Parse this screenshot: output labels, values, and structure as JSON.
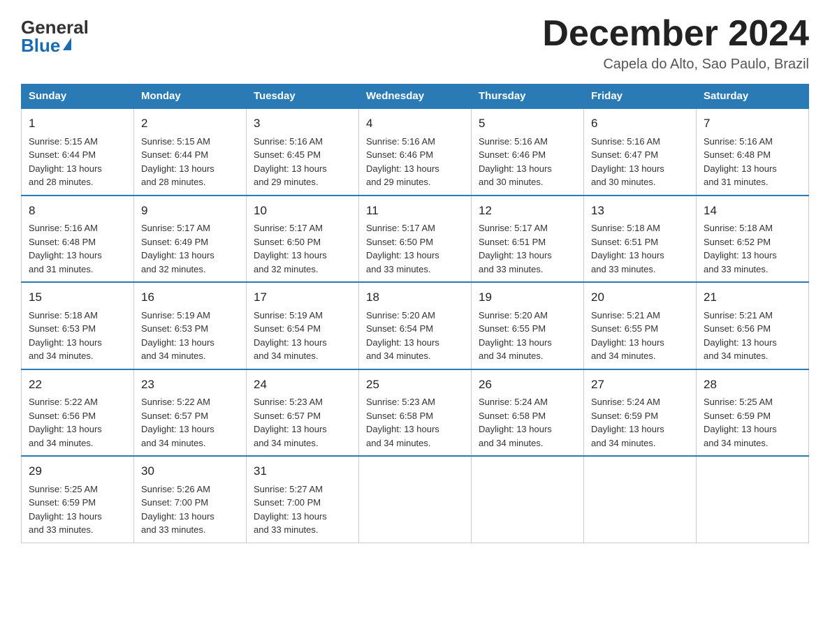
{
  "header": {
    "logo_general": "General",
    "logo_blue": "Blue",
    "month_year": "December 2024",
    "location": "Capela do Alto, Sao Paulo, Brazil"
  },
  "days_of_week": [
    "Sunday",
    "Monday",
    "Tuesday",
    "Wednesday",
    "Thursday",
    "Friday",
    "Saturday"
  ],
  "weeks": [
    [
      {
        "day": "1",
        "sunrise": "5:15 AM",
        "sunset": "6:44 PM",
        "daylight": "13 hours and 28 minutes."
      },
      {
        "day": "2",
        "sunrise": "5:15 AM",
        "sunset": "6:44 PM",
        "daylight": "13 hours and 28 minutes."
      },
      {
        "day": "3",
        "sunrise": "5:16 AM",
        "sunset": "6:45 PM",
        "daylight": "13 hours and 29 minutes."
      },
      {
        "day": "4",
        "sunrise": "5:16 AM",
        "sunset": "6:46 PM",
        "daylight": "13 hours and 29 minutes."
      },
      {
        "day": "5",
        "sunrise": "5:16 AM",
        "sunset": "6:46 PM",
        "daylight": "13 hours and 30 minutes."
      },
      {
        "day": "6",
        "sunrise": "5:16 AM",
        "sunset": "6:47 PM",
        "daylight": "13 hours and 30 minutes."
      },
      {
        "day": "7",
        "sunrise": "5:16 AM",
        "sunset": "6:48 PM",
        "daylight": "13 hours and 31 minutes."
      }
    ],
    [
      {
        "day": "8",
        "sunrise": "5:16 AM",
        "sunset": "6:48 PM",
        "daylight": "13 hours and 31 minutes."
      },
      {
        "day": "9",
        "sunrise": "5:17 AM",
        "sunset": "6:49 PM",
        "daylight": "13 hours and 32 minutes."
      },
      {
        "day": "10",
        "sunrise": "5:17 AM",
        "sunset": "6:50 PM",
        "daylight": "13 hours and 32 minutes."
      },
      {
        "day": "11",
        "sunrise": "5:17 AM",
        "sunset": "6:50 PM",
        "daylight": "13 hours and 33 minutes."
      },
      {
        "day": "12",
        "sunrise": "5:17 AM",
        "sunset": "6:51 PM",
        "daylight": "13 hours and 33 minutes."
      },
      {
        "day": "13",
        "sunrise": "5:18 AM",
        "sunset": "6:51 PM",
        "daylight": "13 hours and 33 minutes."
      },
      {
        "day": "14",
        "sunrise": "5:18 AM",
        "sunset": "6:52 PM",
        "daylight": "13 hours and 33 minutes."
      }
    ],
    [
      {
        "day": "15",
        "sunrise": "5:18 AM",
        "sunset": "6:53 PM",
        "daylight": "13 hours and 34 minutes."
      },
      {
        "day": "16",
        "sunrise": "5:19 AM",
        "sunset": "6:53 PM",
        "daylight": "13 hours and 34 minutes."
      },
      {
        "day": "17",
        "sunrise": "5:19 AM",
        "sunset": "6:54 PM",
        "daylight": "13 hours and 34 minutes."
      },
      {
        "day": "18",
        "sunrise": "5:20 AM",
        "sunset": "6:54 PM",
        "daylight": "13 hours and 34 minutes."
      },
      {
        "day": "19",
        "sunrise": "5:20 AM",
        "sunset": "6:55 PM",
        "daylight": "13 hours and 34 minutes."
      },
      {
        "day": "20",
        "sunrise": "5:21 AM",
        "sunset": "6:55 PM",
        "daylight": "13 hours and 34 minutes."
      },
      {
        "day": "21",
        "sunrise": "5:21 AM",
        "sunset": "6:56 PM",
        "daylight": "13 hours and 34 minutes."
      }
    ],
    [
      {
        "day": "22",
        "sunrise": "5:22 AM",
        "sunset": "6:56 PM",
        "daylight": "13 hours and 34 minutes."
      },
      {
        "day": "23",
        "sunrise": "5:22 AM",
        "sunset": "6:57 PM",
        "daylight": "13 hours and 34 minutes."
      },
      {
        "day": "24",
        "sunrise": "5:23 AM",
        "sunset": "6:57 PM",
        "daylight": "13 hours and 34 minutes."
      },
      {
        "day": "25",
        "sunrise": "5:23 AM",
        "sunset": "6:58 PM",
        "daylight": "13 hours and 34 minutes."
      },
      {
        "day": "26",
        "sunrise": "5:24 AM",
        "sunset": "6:58 PM",
        "daylight": "13 hours and 34 minutes."
      },
      {
        "day": "27",
        "sunrise": "5:24 AM",
        "sunset": "6:59 PM",
        "daylight": "13 hours and 34 minutes."
      },
      {
        "day": "28",
        "sunrise": "5:25 AM",
        "sunset": "6:59 PM",
        "daylight": "13 hours and 34 minutes."
      }
    ],
    [
      {
        "day": "29",
        "sunrise": "5:25 AM",
        "sunset": "6:59 PM",
        "daylight": "13 hours and 33 minutes."
      },
      {
        "day": "30",
        "sunrise": "5:26 AM",
        "sunset": "7:00 PM",
        "daylight": "13 hours and 33 minutes."
      },
      {
        "day": "31",
        "sunrise": "5:27 AM",
        "sunset": "7:00 PM",
        "daylight": "13 hours and 33 minutes."
      },
      null,
      null,
      null,
      null
    ]
  ],
  "labels": {
    "sunrise": "Sunrise:",
    "sunset": "Sunset:",
    "daylight": "Daylight:"
  }
}
